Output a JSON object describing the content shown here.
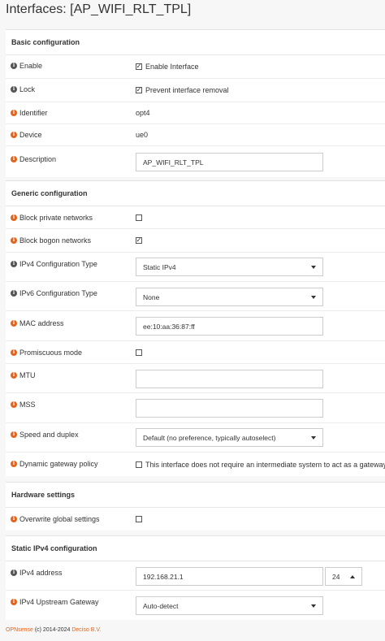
{
  "page": {
    "title": "Interfaces: [AP_WIFI_RLT_TPL]"
  },
  "colors": {
    "accent": "#e2651f",
    "info_grey": "#555555"
  },
  "basic": {
    "heading": "Basic configuration",
    "enable_label": "Enable",
    "enable_checkbox_text": "Enable Interface",
    "enable_checked": true,
    "lock_label": "Lock",
    "lock_checkbox_text": "Prevent interface removal",
    "lock_checked": true,
    "identifier_label": "Identifier",
    "identifier_value": "opt4",
    "device_label": "Device",
    "device_value": "ue0",
    "description_label": "Description",
    "description_value": "AP_WIFI_RLT_TPL"
  },
  "generic": {
    "heading": "Generic configuration",
    "block_private_label": "Block private networks",
    "block_private_checked": false,
    "block_bogon_label": "Block bogon networks",
    "block_bogon_checked": true,
    "ipv4_type_label": "IPv4 Configuration Type",
    "ipv4_type_value": "Static IPv4",
    "ipv6_type_label": "IPv6 Configuration Type",
    "ipv6_type_value": "None",
    "mac_label": "MAC address",
    "mac_value": "ee:10:aa:36:87:ff",
    "promisc_label": "Promiscuous mode",
    "promisc_checked": false,
    "mtu_label": "MTU",
    "mtu_value": "",
    "mss_label": "MSS",
    "mss_value": "",
    "speed_label": "Speed and duplex",
    "speed_value": "Default (no preference, typically autoselect)",
    "dyn_gw_label": "Dynamic gateway policy",
    "dyn_gw_text": "This interface does not require an intermediate system to act as a gateway",
    "dyn_gw_checked": false
  },
  "hardware": {
    "heading": "Hardware settings",
    "overwrite_label": "Overwrite global settings",
    "overwrite_checked": false
  },
  "static_ipv4": {
    "heading": "Static IPv4 configuration",
    "address_label": "IPv4 address",
    "address_value": "192.168.21.1",
    "prefix_value": "24",
    "gateway_label": "IPv4 Upstream Gateway",
    "gateway_value": "Auto-detect"
  },
  "footer": {
    "brand": "OPNsense",
    "copyright": "(c) 2014-2024",
    "vendor": "Deciso B.V."
  }
}
